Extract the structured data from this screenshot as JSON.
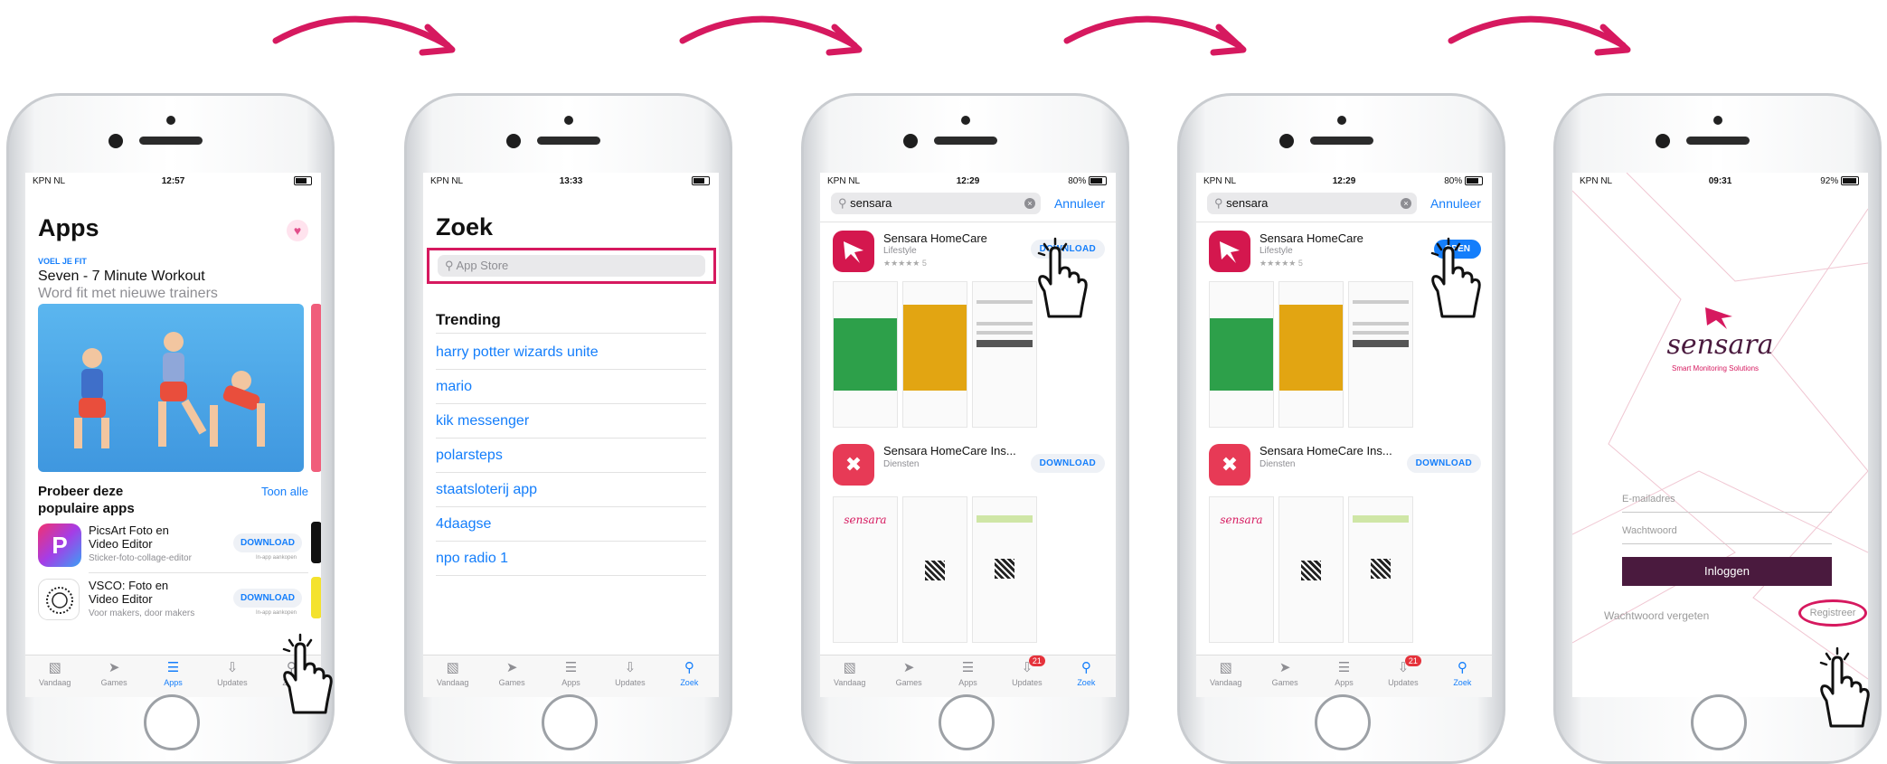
{
  "colors": {
    "accent": "#147efb",
    "brand": "#d6195f",
    "arrow": "#d6195f",
    "sensara": "#4a1a3e"
  },
  "tabs": [
    {
      "label": "Vandaag",
      "icon": "today-icon"
    },
    {
      "label": "Games",
      "icon": "rocket-icon"
    },
    {
      "label": "Apps",
      "icon": "layers-icon"
    },
    {
      "label": "Updates",
      "icon": "download-icon"
    },
    {
      "label": "Zoek",
      "icon": "search-icon"
    }
  ],
  "phone1": {
    "status": {
      "carrier": "KPN NL",
      "time": "12:57"
    },
    "title": "Apps",
    "feature": {
      "eyebrow": "VOEL JE FIT",
      "title": "Seven - 7 Minute Workout",
      "subtitle": "Word fit met nieuwe trainers"
    },
    "section_title_1": "Probeer deze",
    "section_title_2": "populaire apps",
    "see_all": "Toon alle",
    "apps": [
      {
        "name_1": "PicsArt Foto en",
        "name_2": "Video Editor",
        "sub": "Sticker-foto-collage-editor",
        "button": "DOWNLOAD",
        "note": "In-app aankopen"
      },
      {
        "name_1": "VSCO: Foto en",
        "name_2": "Video Editor",
        "sub": "Voor makers, door makers",
        "button": "DOWNLOAD",
        "note": "In-app aankopen"
      }
    ]
  },
  "phone2": {
    "status": {
      "carrier": "KPN NL",
      "time": "13:33"
    },
    "title": "Zoek",
    "search_placeholder": "App Store",
    "trending_title": "Trending",
    "trending": [
      "harry potter wizards unite",
      "mario",
      "kik messenger",
      "polarsteps",
      "staatsloterij app",
      "4daagse",
      "npo radio 1"
    ]
  },
  "phone3": {
    "status": {
      "carrier": "KPN NL",
      "time": "12:29",
      "battery": "80%"
    },
    "search_value": "sensara",
    "cancel": "Annuleer",
    "results": [
      {
        "name": "Sensara HomeCare",
        "category": "Lifestyle",
        "rating_count": "5",
        "button": "DOWNLOAD"
      },
      {
        "name": "Sensara HomeCare Ins...",
        "category": "Diensten",
        "button": "DOWNLOAD"
      }
    ],
    "badge": "21"
  },
  "phone4": {
    "status": {
      "carrier": "KPN NL",
      "time": "12:29",
      "battery": "80%"
    },
    "search_value": "sensara",
    "cancel": "Annuleer",
    "results": [
      {
        "name": "Sensara HomeCare",
        "category": "Lifestyle",
        "rating_count": "5",
        "button": "OPEN"
      },
      {
        "name": "Sensara HomeCare Ins...",
        "category": "Diensten",
        "button": "DOWNLOAD"
      }
    ],
    "badge": "21"
  },
  "phone5": {
    "status": {
      "carrier": "KPN NL",
      "time": "09:31",
      "battery": "92%"
    },
    "logo": "sensara",
    "tagline": "Smart Monitoring Solutions",
    "email_placeholder": "E-mailadres",
    "password_placeholder": "Wachtwoord",
    "login_button": "Inloggen",
    "forgot": "Wachtwoord vergeten",
    "register": "Registreer"
  }
}
